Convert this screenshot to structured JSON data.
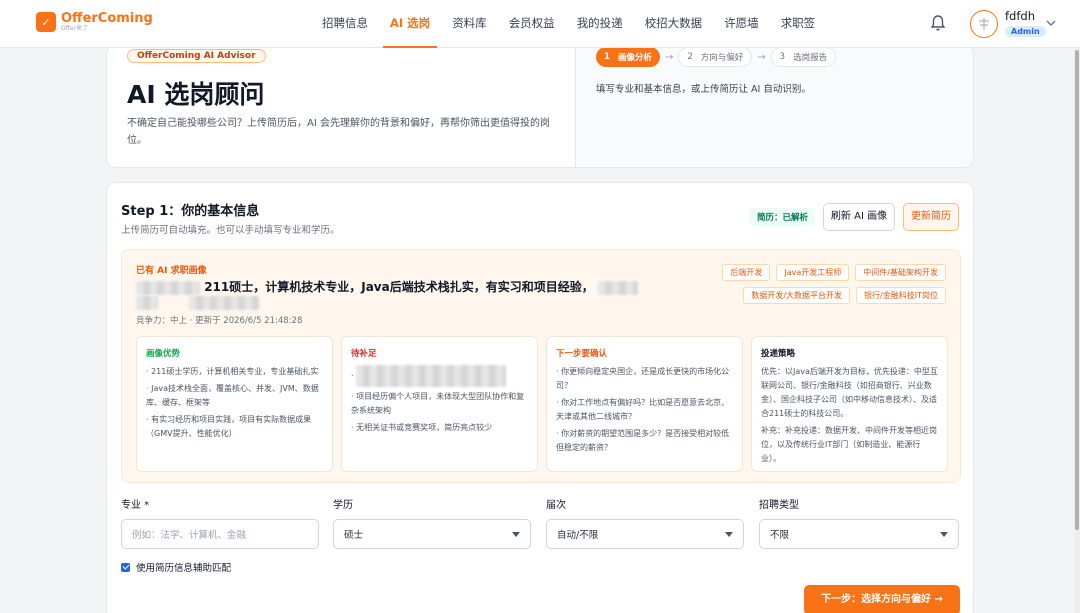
{
  "brand": {
    "name": "OfferComing",
    "sub": "Offer来了"
  },
  "nav": {
    "items": [
      {
        "label": "招聘信息"
      },
      {
        "label": "AI 选岗"
      },
      {
        "label": "资料库"
      },
      {
        "label": "会员权益"
      },
      {
        "label": "我的投递"
      },
      {
        "label": "校招大数据"
      },
      {
        "label": "许愿墙"
      },
      {
        "label": "求职签"
      }
    ],
    "active_index": 1
  },
  "user": {
    "name": "fdfdh",
    "badge": "Admin"
  },
  "hero": {
    "pill": "OfferComing AI Advisor",
    "title": "AI 选岗顾问",
    "desc": "不确定自己能投哪些公司？上传简历后，AI 会先理解你的背景和偏好，再帮你筛出更值得投的岗位。",
    "steps": [
      {
        "num": "1",
        "label": "画像分析",
        "active": true
      },
      {
        "num": "2",
        "label": "方向与偏好",
        "active": false
      },
      {
        "num": "3",
        "label": "选岗报告",
        "active": false
      }
    ],
    "right_desc": "填写专业和基本信息，或上传简历让 AI 自动识别。"
  },
  "step1": {
    "title": "Step 1：你的基本信息",
    "desc": "上传简历可自动填充。也可以手动填写专业和学历。",
    "parsed_badge": "简历：已解析",
    "refresh_label": "刷新 AI 画像",
    "update_label": "更新简历"
  },
  "profile": {
    "label": "已有 AI 求职画像",
    "summary": "211硕士，计算机技术专业，Java后端技术栈扎实，有实习和项目经验，",
    "meta": "竞争力：中上 · 更新于 2026/6/5 21:48:28",
    "tags": [
      "后端开发",
      "Java开发工程师",
      "中间件/基础架构开发",
      "数据开发/大数据平台开发",
      "银行/金融科技IT岗位"
    ],
    "cards": [
      {
        "title": "画像优势",
        "color": "#16a34a",
        "items": [
          "· 211硕士学历，计算机相关专业，专业基础扎实",
          "· Java技术栈全面，覆盖核心、并发、JVM、数据库、缓存、框架等",
          "· 有实习经历和项目实践，项目有实际数据成果（GMV提升、性能优化）"
        ]
      },
      {
        "title": "待补足",
        "color": "#dc2626",
        "items": [
          "· ",
          "· 项目经历偏个人项目，未体现大型团队协作和复杂系统架构",
          "· 无相关证书或竞赛奖项，简历亮点较少"
        ]
      },
      {
        "title": "下一步要确认",
        "color": "#ea580c",
        "items": [
          "· 你更倾向稳定央国企，还是成长更快的市场化公司？",
          "· 你对工作地点有偏好吗？比如是否愿意去北京、天津或其他二线城市？",
          "· 你对薪资的期望范围是多少？是否接受相对较低但稳定的薪资？"
        ]
      },
      {
        "title": "投递策略",
        "color": "#111827",
        "items": [
          "优先：以Java后端开发为目标，优先投递：中型互联网公司、银行/金融科技（如招商银行、兴业数金）、国企科技子公司（如中移动信息技术）、及适合211硕士的科技公司。",
          "补充：补充投递：数据开发、中间件开发等相近岗位，以及传统行业IT部门（如制造业、能源行业）。"
        ]
      }
    ]
  },
  "form": {
    "major_label": "专业 *",
    "major_placeholder": "例如：法学、计算机、金融",
    "degree_label": "学历",
    "degree_value": "硕士",
    "cohort_label": "届次",
    "cohort_value": "自动/不限",
    "recruit_label": "招聘类型",
    "recruit_value": "不限",
    "checkbox_label": "使用简历信息辅助匹配",
    "checkbox_checked": true,
    "next_label": "下一步：选择方向与偏好 →"
  }
}
